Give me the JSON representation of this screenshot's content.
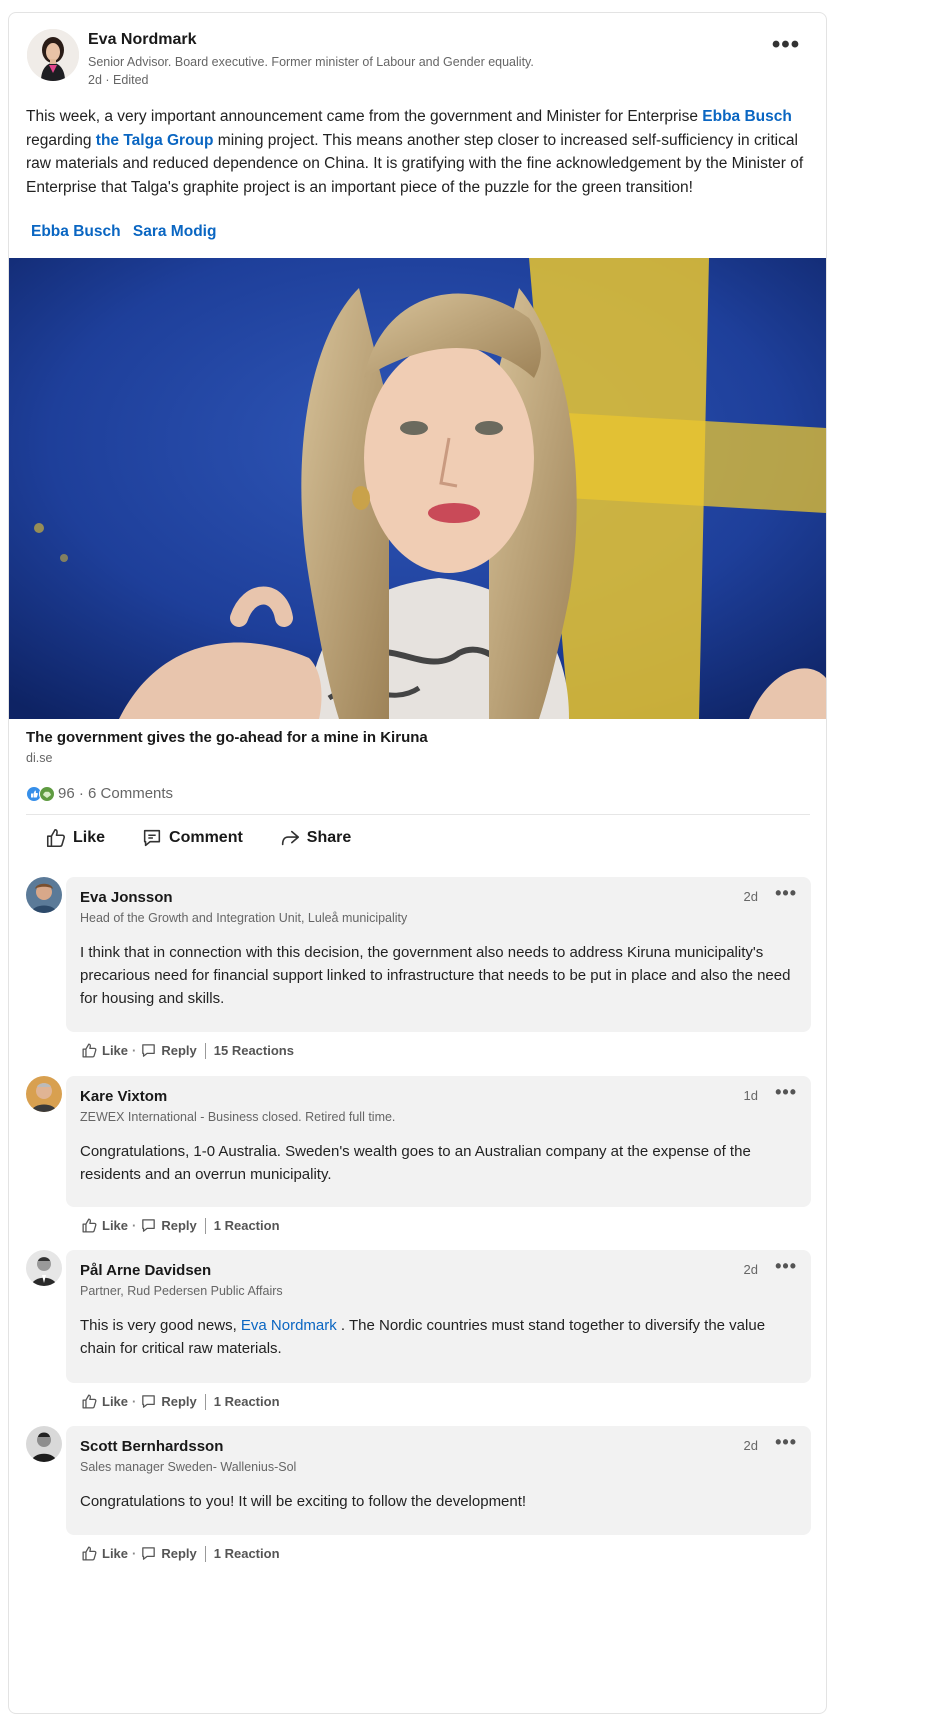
{
  "post": {
    "author": {
      "name": "Eva Nordmark",
      "headline": "Senior Advisor. Board executive. Former minister of Labour and Gender equality.",
      "time": "2d",
      "edited": "Edited"
    },
    "text_parts": [
      "This week, a very important announcement came from the government and Minister for Enterprise ",
      "Ebba Busch",
      " regarding ",
      "the Talga Group",
      " mining project. This means another step closer to increased self-sufficiency in critical raw materials and reduced dependence on China. It is gratifying with the fine acknowledgement by the Minister of Enterprise that Talga's graphite project is an important piece of the puzzle for the green transition!"
    ],
    "tags": [
      "Ebba Busch",
      "Sara Modig"
    ],
    "link": {
      "title": "The government gives the go-ahead for a mine in Kiruna",
      "source": "di.se"
    },
    "counts": "96 · 6 Comments",
    "actions": {
      "like": "Like",
      "comment": "Comment",
      "share": "Share"
    }
  },
  "comments": [
    {
      "name": "Eva Jonsson",
      "headline": "Head of the Growth and Integration Unit, Luleå municipality",
      "time": "2d",
      "text": "I think that in connection with this decision, the government also needs to address Kiruna municipality's precarious need for financial support linked to infrastructure that needs to be put in place and also the need for housing and skills.",
      "like": "Like",
      "reply": "Reply",
      "reactions": "15 Reactions"
    },
    {
      "name": "Kare Vixtom",
      "headline": "ZEWEX International - Business closed. Retired full time.",
      "time": "1d",
      "text": "Congratulations, 1-0 Australia. Sweden's wealth goes to an Australian company at the expense of the residents and an overrun municipality.",
      "like": "Like",
      "reply": "Reply",
      "reactions": "1 Reaction"
    },
    {
      "name": "Pål Arne Davidsen",
      "headline": "Partner, Rud Pedersen Public Affairs",
      "time": "2d",
      "text_before": "This is very good news, ",
      "mention": "Eva Nordmark",
      "text_after": " . The Nordic countries must stand together to diversify the value chain for critical raw materials.",
      "like": "Like",
      "reply": "Reply",
      "reactions": "1 Reaction"
    },
    {
      "name": "Scott Bernhardsson",
      "headline": "Sales manager Sweden- Wallenius-Sol",
      "time": "2d",
      "text": "Congratulations to you! It will be exciting to follow the development!",
      "like": "Like",
      "reply": "Reply",
      "reactions": "1 Reaction"
    }
  ],
  "icons": {
    "more": "more-horizontal-icon",
    "like": "thumbs-up-icon",
    "comment": "comment-bubble-icon",
    "share": "share-arrow-icon"
  },
  "colors": {
    "link": "#0a66c2",
    "bubble": "#f2f2f2",
    "text": "#191919"
  }
}
